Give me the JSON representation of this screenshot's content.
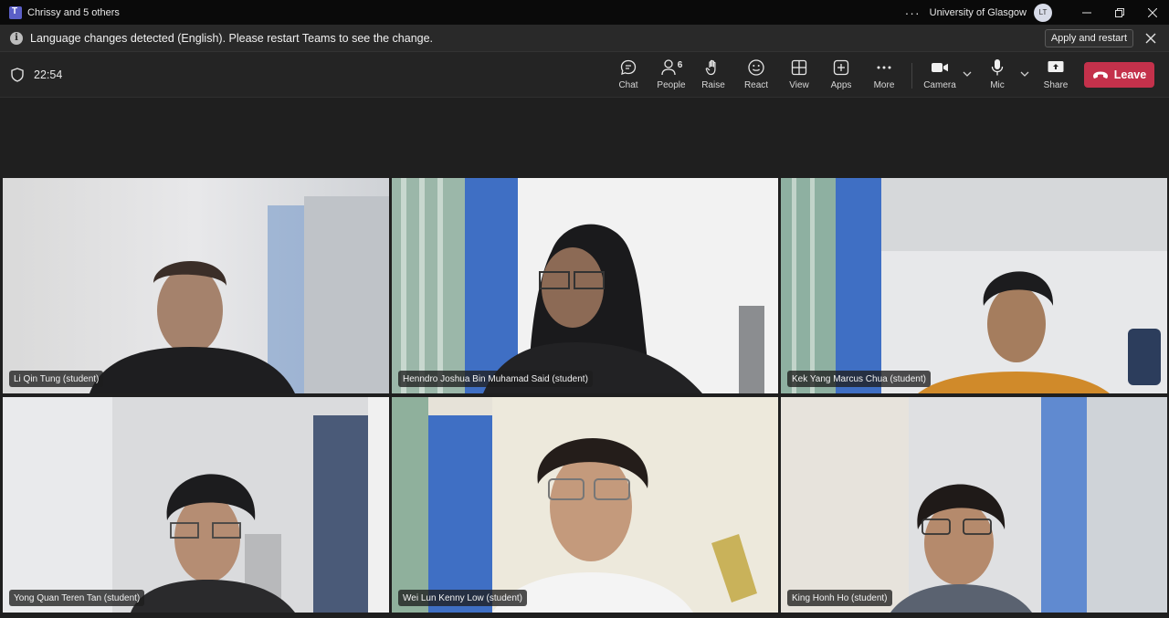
{
  "window": {
    "title": "Chrissy and 5 others",
    "more_dots": "···",
    "organization": "University of Glasgow",
    "avatar_initials": "LT"
  },
  "banner": {
    "message": "Language changes detected (English). Please restart Teams to see the change.",
    "apply_label": "Apply and restart"
  },
  "meeting": {
    "timer": "22:54",
    "people_count": "6",
    "buttons": {
      "chat": "Chat",
      "people": "People",
      "raise": "Raise",
      "react": "React",
      "view": "View",
      "apps": "Apps",
      "more": "More",
      "camera": "Camera",
      "mic": "Mic",
      "share": "Share",
      "leave": "Leave"
    }
  },
  "participants": [
    {
      "name": "Li Qin Tung (student)"
    },
    {
      "name": "Henndro Joshua Bin Muhamad Said (student)"
    },
    {
      "name": "Kek Yang Marcus Chua (student)"
    },
    {
      "name": "Yong Quan Teren Tan (student)"
    },
    {
      "name": "Wei Lun Kenny Low (student)"
    },
    {
      "name": "King Honh Ho (student)"
    }
  ],
  "colors": {
    "leave": "#c4314b",
    "teams_purple": "#5b5fc7",
    "wall_blue": "#3f6fc4"
  }
}
